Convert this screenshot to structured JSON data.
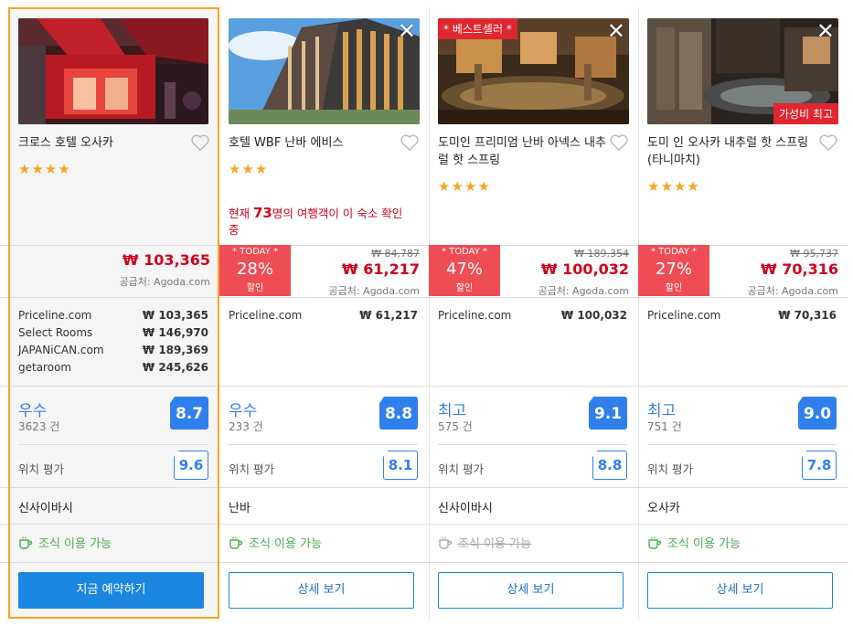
{
  "hotels": [
    {
      "name": "크로스 호텔 오사카",
      "stars": "★★★★",
      "price": "₩ 103,365",
      "supplier": "공급처: Agoda.com",
      "providers": [
        {
          "name": "Priceline.com",
          "price": "₩ 103,365"
        },
        {
          "name": "Select Rooms",
          "price": "₩ 146,970"
        },
        {
          "name": "JAPANiCAN.com",
          "price": "₩ 189,369"
        },
        {
          "name": "getaroom",
          "price": "₩ 245,626"
        }
      ],
      "score_word": "우수",
      "review_count": "3623 건",
      "score": "8.7",
      "location_label": "위치 평가",
      "location_score": "9.6",
      "area": "신사이바시",
      "breakfast": "조식 이용 가능",
      "button": "지금 예약하기"
    },
    {
      "name": "호텔 WBF 난바 에비스",
      "stars": "★★★",
      "viewers_prefix": "현재 ",
      "viewers_count": "73",
      "viewers_suffix": "명의 여행객이 이 숙소 확인 중",
      "discount_label": "* TODAY *",
      "discount_pct": "28%",
      "discount_sale": "할인",
      "old_price": "₩ 84,787",
      "price": "₩ 61,217",
      "supplier": "공급처: Agoda.com",
      "providers": [
        {
          "name": "Priceline.com",
          "price": "₩ 61,217"
        }
      ],
      "score_word": "우수",
      "review_count": "233 건",
      "score": "8.8",
      "location_label": "위치 평가",
      "location_score": "8.1",
      "area": "난바",
      "breakfast": "조식 이용 가능",
      "button": "상세 보기"
    },
    {
      "name": "도미인 프리미엄 난바 아넥스 내추럴 핫 스프링",
      "stars": "★★★★",
      "badge": "* 베스트셀러 *",
      "discount_label": "* TODAY *",
      "discount_pct": "47%",
      "discount_sale": "할인",
      "old_price": "₩ 189,354",
      "price": "₩ 100,032",
      "supplier": "공급처: Agoda.com",
      "providers": [
        {
          "name": "Priceline.com",
          "price": "₩ 100,032"
        }
      ],
      "score_word": "최고",
      "review_count": "575 건",
      "score": "9.1",
      "location_label": "위치 평가",
      "location_score": "8.8",
      "area": "신사이바시",
      "breakfast": "조식 이용 가능",
      "button": "상세 보기"
    },
    {
      "name": "도미 인 오사카 내추럴 핫 스프링 (타니마치)",
      "stars": "★★★★",
      "badge": "가성비 최고",
      "discount_label": "* TODAY *",
      "discount_pct": "27%",
      "discount_sale": "할인",
      "old_price": "₩ 95,737",
      "price": "₩ 70,316",
      "supplier": "공급처: Agoda.com",
      "providers": [
        {
          "name": "Priceline.com",
          "price": "₩ 70,316"
        }
      ],
      "score_word": "최고",
      "review_count": "751 건",
      "score": "9.0",
      "location_label": "위치 평가",
      "location_score": "7.8",
      "area": "오사카",
      "breakfast": "조식 이용 가능",
      "button": "상세 보기"
    }
  ],
  "colors": {
    "accent": "#1b86e0",
    "price_red": "#d0021b",
    "discount_red": "#ee4d55",
    "score_blue": "#2f80ed",
    "star": "#f5a623",
    "breakfast_green": "#4caf50",
    "selected_border": "#f5a623"
  },
  "icons": {
    "close": "close-icon",
    "heart": "heart-icon",
    "breakfast": "coffee-cup-icon"
  }
}
